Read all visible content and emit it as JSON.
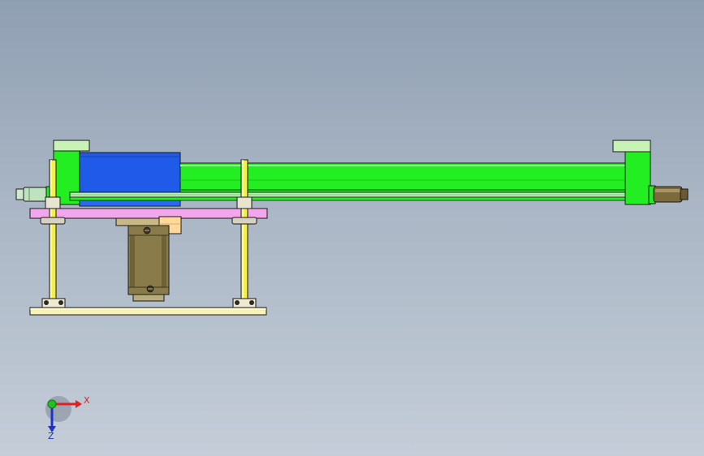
{
  "viewport": {
    "background_top": "#8f9fb2",
    "background_bottom": "#c4cdd8"
  },
  "colors": {
    "cylinder": "#22ee22",
    "cylinder_dark": "#0f9a10",
    "housing_blue": "#1f5be8",
    "plate_pink": "#f2a6ec",
    "plate_yellow": "#f7f2b8",
    "guide_rod": "#f4f04a",
    "motor": "#8a7c4a",
    "motor_light": "#ffd89a",
    "end_fitting": "#7a6a3c",
    "line": "#1a1a1a"
  },
  "triad": {
    "x_label": "X",
    "z_label": "Z",
    "x_color": "#e02020",
    "z_color": "#2030d0",
    "y_color": "#20c020"
  }
}
